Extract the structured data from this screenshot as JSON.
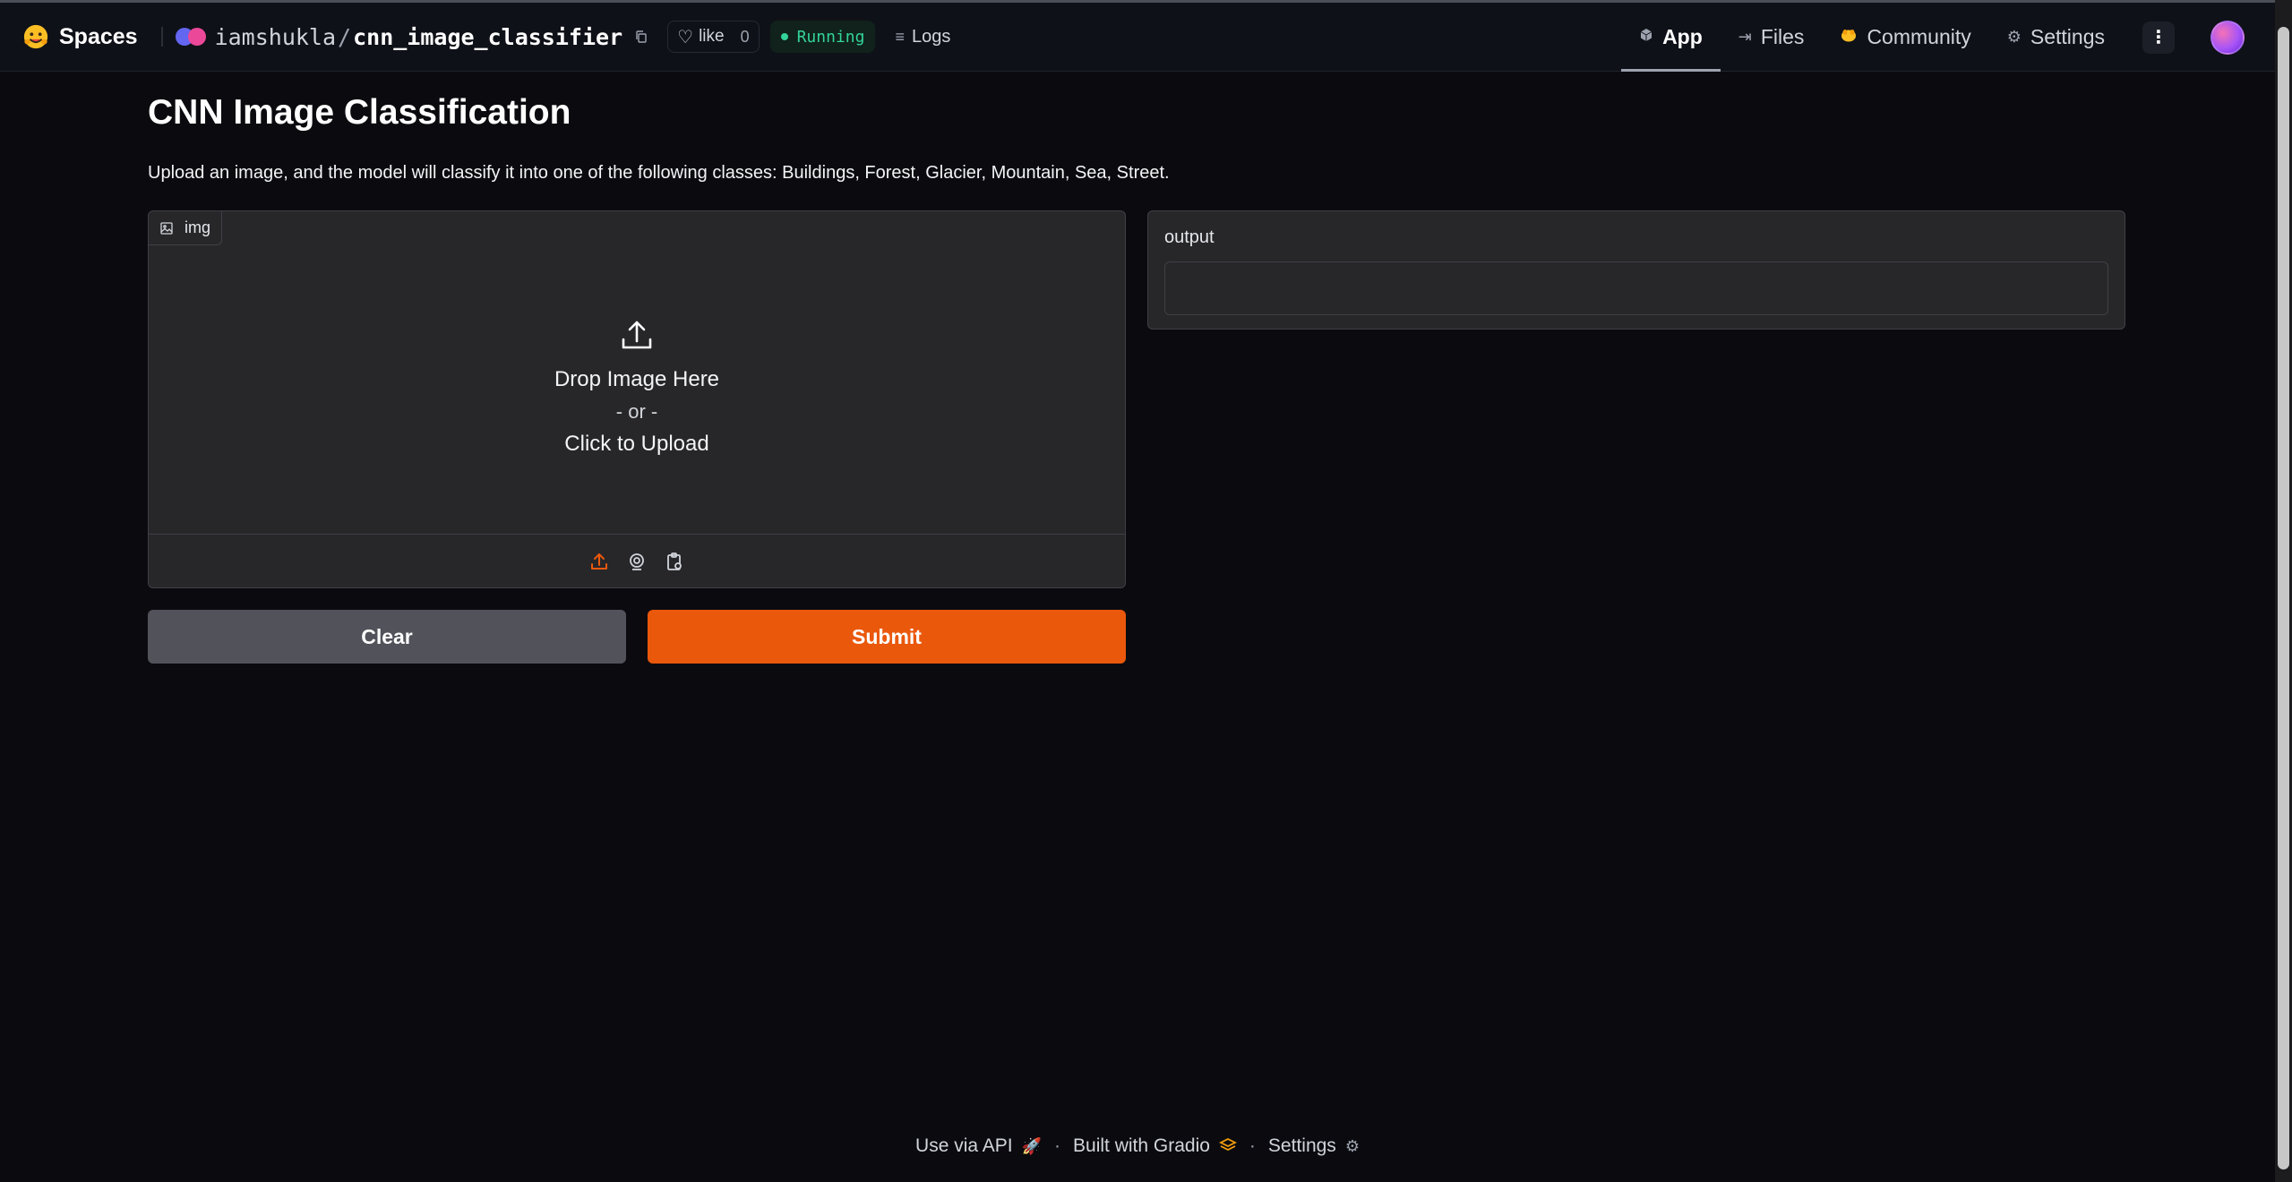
{
  "header": {
    "brand_label": "Spaces",
    "owner": "iamshukla",
    "slash": "/",
    "repo_name": "cnn_image_classifier",
    "like_label": "like",
    "like_count": "0",
    "status": "Running",
    "logs_label": "Logs",
    "tabs": [
      {
        "label": "App"
      },
      {
        "label": "Files"
      },
      {
        "label": "Community"
      },
      {
        "label": "Settings"
      }
    ],
    "more_label": "⋮"
  },
  "main": {
    "title": "CNN Image Classification",
    "description": "Upload an image, and the model will classify it into one of the following classes: Buildings, Forest, Glacier, Mountain, Sea, Street.",
    "image_input": {
      "label": "img",
      "drop_text": "Drop Image Here",
      "or_text": "- or -",
      "click_text": "Click to Upload"
    },
    "output": {
      "label": "output",
      "value": ""
    },
    "buttons": {
      "clear": "Clear",
      "submit": "Submit"
    }
  },
  "footer": {
    "api": "Use via API",
    "built": "Built with Gradio",
    "settings": "Settings",
    "separator": "·"
  },
  "colors": {
    "accent": "#ea580c",
    "status": "#34d399",
    "background": "#0b0b0f",
    "panel": "#27272a",
    "clear_button": "#52525b"
  }
}
